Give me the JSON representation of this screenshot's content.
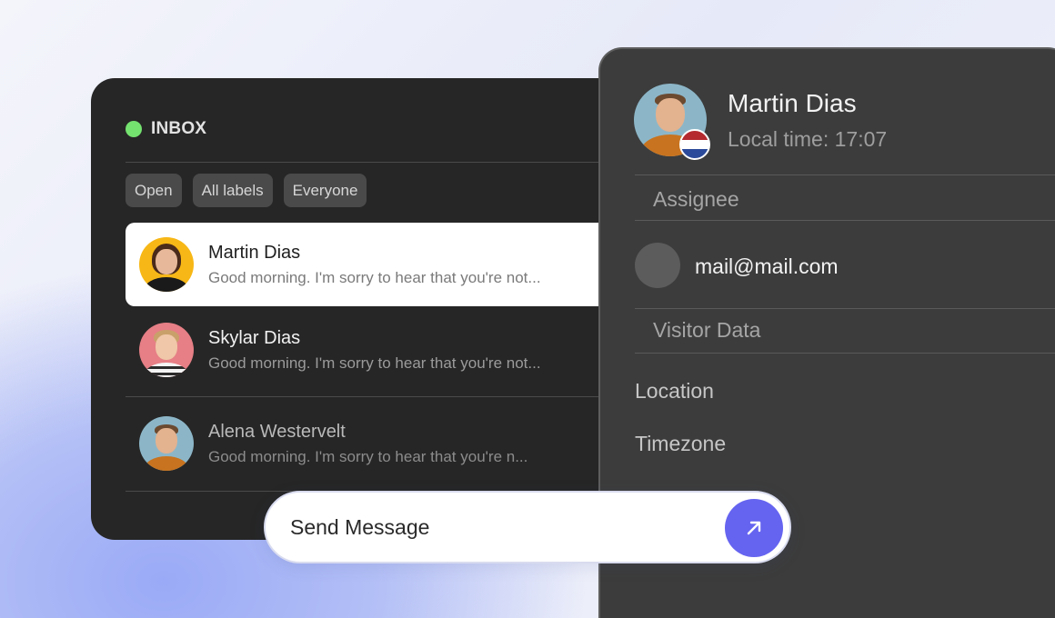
{
  "inbox": {
    "title": "INBOX",
    "status_color": "#74e26f",
    "filters": [
      {
        "label": "Open"
      },
      {
        "label": "All labels"
      },
      {
        "label": "Everyone"
      }
    ],
    "conversations": [
      {
        "name": "Martin Dias",
        "snippet": "Good morning. I'm sorry to hear that you're not...",
        "avatar_color": "#f7b716",
        "active": true
      },
      {
        "name": "Skylar Dias",
        "snippet": "Good morning. I'm sorry to hear that you're not...",
        "avatar_color": "#e67f86",
        "active": false
      },
      {
        "name": "Alena Westervelt",
        "snippet": "Good morning. I'm sorry to hear that you're n...",
        "avatar_color": "#8cb6c8",
        "active": false
      }
    ]
  },
  "profile": {
    "name": "Martin Dias",
    "local_time": "Local time: 17:07",
    "flag_icon": "netherlands-flag-icon",
    "assignee_label": "Assignee",
    "email": "mail@mail.com",
    "visitor_data_label": "Visitor Data",
    "fields": [
      {
        "label": "Location"
      },
      {
        "label": "Timezone"
      }
    ]
  },
  "composer": {
    "placeholder": "Send Message",
    "send_icon": "arrow-up-right-icon",
    "accent_color": "#6564f0"
  }
}
